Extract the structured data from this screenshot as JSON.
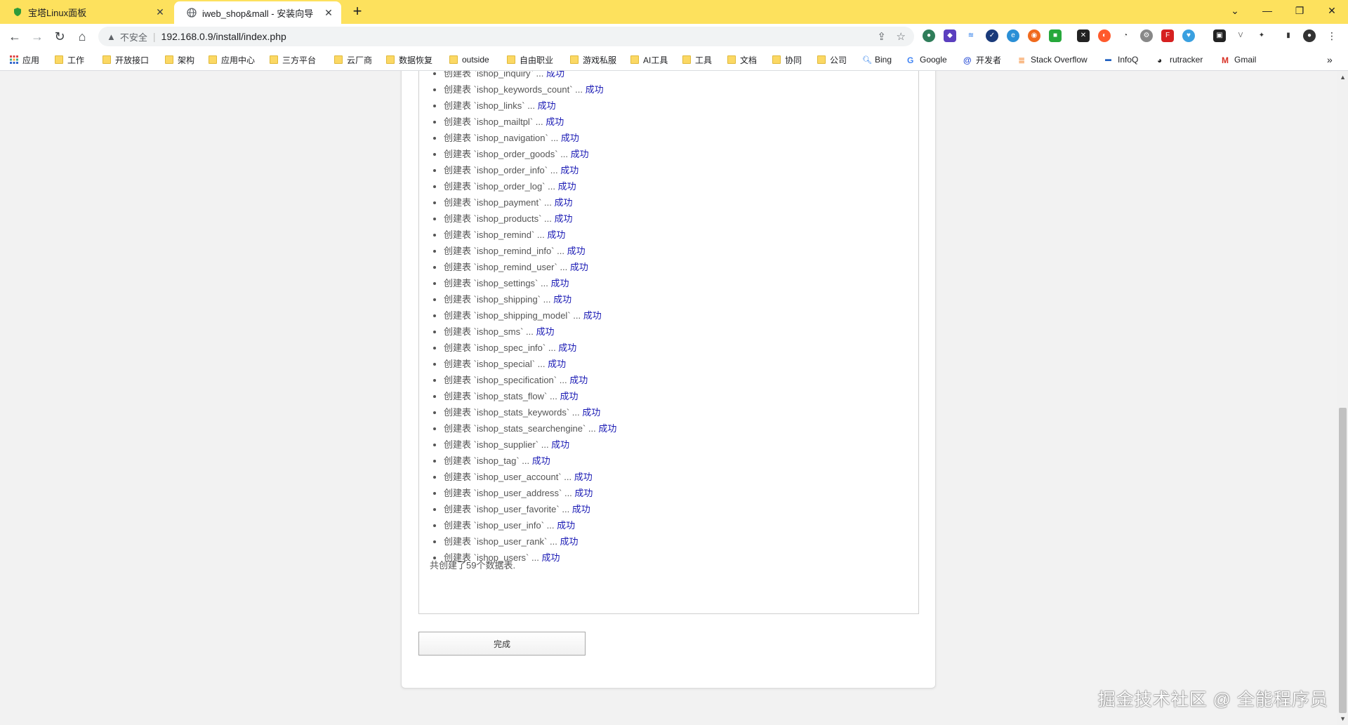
{
  "browser": {
    "tabs": [
      {
        "title": "宝塔Linux面板",
        "active": false,
        "icon": "baota-shield-icon"
      },
      {
        "title": "iweb_shop&mall - 安装向导",
        "active": true,
        "icon": "globe-icon"
      }
    ],
    "address": {
      "security_label": "不安全",
      "url": "192.168.0.9/install/index.php"
    },
    "bookmarks": [
      {
        "label": "应用",
        "icon": "apps-grid-icon"
      },
      {
        "label": "工作",
        "icon": "folder-icon"
      },
      {
        "label": "开放接口",
        "icon": "folder-icon"
      },
      {
        "label": "架构",
        "icon": "folder-icon"
      },
      {
        "label": "应用中心",
        "icon": "folder-icon"
      },
      {
        "label": "三方平台",
        "icon": "folder-icon"
      },
      {
        "label": "云厂商",
        "icon": "folder-icon"
      },
      {
        "label": "数据恢复",
        "icon": "folder-icon"
      },
      {
        "label": "outside",
        "icon": "folder-icon"
      },
      {
        "label": "自由职业",
        "icon": "folder-icon"
      },
      {
        "label": "游戏私服",
        "icon": "folder-icon"
      },
      {
        "label": "AI工具",
        "icon": "folder-icon"
      },
      {
        "label": "工具",
        "icon": "folder-icon"
      },
      {
        "label": "文档",
        "icon": "folder-icon"
      },
      {
        "label": "协同",
        "icon": "folder-icon"
      },
      {
        "label": "公司",
        "icon": "folder-icon"
      },
      {
        "label": "Bing",
        "icon": "search-icon"
      },
      {
        "label": "Google",
        "icon": "google-icon"
      },
      {
        "label": "开发者",
        "icon": "developer-icon"
      },
      {
        "label": "Stack Overflow",
        "icon": "stackoverflow-icon"
      },
      {
        "label": "InfoQ",
        "icon": "infoq-icon"
      },
      {
        "label": "rutracker",
        "icon": "rutracker-icon"
      },
      {
        "label": "Gmail",
        "icon": "gmail-icon"
      }
    ],
    "bookmarks_overflow": "»"
  },
  "install": {
    "prefix": "创建表",
    "dots": "...",
    "status": "成功",
    "tables": [
      "ishop_inquiry",
      "ishop_keywords_count",
      "ishop_links",
      "ishop_mailtpl",
      "ishop_navigation",
      "ishop_order_goods",
      "ishop_order_info",
      "ishop_order_log",
      "ishop_payment",
      "ishop_products",
      "ishop_remind",
      "ishop_remind_info",
      "ishop_remind_user",
      "ishop_settings",
      "ishop_shipping",
      "ishop_shipping_model",
      "ishop_sms",
      "ishop_spec_info",
      "ishop_special",
      "ishop_specification",
      "ishop_stats_flow",
      "ishop_stats_keywords",
      "ishop_stats_searchengine",
      "ishop_supplier",
      "ishop_tag",
      "ishop_user_account",
      "ishop_user_address",
      "ishop_user_favorite",
      "ishop_user_info",
      "ishop_user_rank",
      "ishop_users"
    ],
    "summary": "共创建了59个数据表.",
    "done_label": "完成"
  },
  "watermark": "掘金技术社区 @ 全能程序员"
}
